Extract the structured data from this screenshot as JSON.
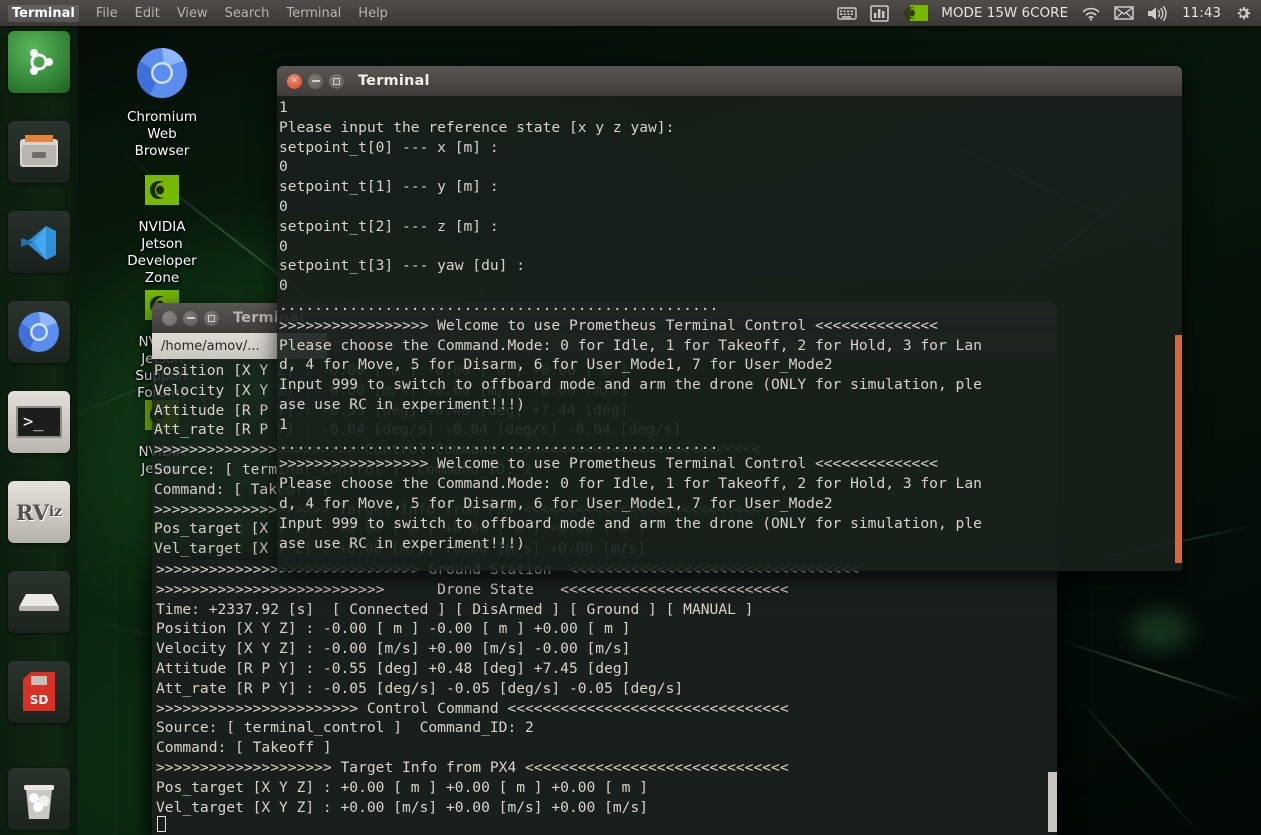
{
  "top_panel": {
    "app_name": "Terminal",
    "menus": [
      "File",
      "Edit",
      "View",
      "Search",
      "Terminal",
      "Help"
    ],
    "indicators": [
      {
        "name": "keyboard-indicator-icon",
        "glyph": "keyboard"
      },
      {
        "name": "system-monitor-icon",
        "glyph": "monitor"
      },
      {
        "name": "nvidia-logo-icon",
        "glyph": "nvidia"
      }
    ],
    "power_mode": "MODE 15W 6CORE",
    "wifi_label": "wifi",
    "mail_label": "mail",
    "volume_label": "volume",
    "clock": "11:43",
    "settings_label": "settings"
  },
  "launcher": {
    "items": [
      {
        "name": "ubuntu-dash-icon",
        "label": "Ubuntu Dash",
        "selected": false
      },
      {
        "name": "files-icon",
        "label": "Files",
        "selected": false
      },
      {
        "name": "vscode-icon",
        "label": "Visual Studio Code",
        "selected": false
      },
      {
        "name": "chromium-icon",
        "label": "Chromium Web Browser",
        "selected": false
      },
      {
        "name": "terminal-icon",
        "label": "Terminal",
        "selected": true
      },
      {
        "name": "rviz-icon",
        "label": "RViz",
        "selected": true
      },
      {
        "name": "disk-drive-icon",
        "label": "Disk Drive",
        "selected": false
      },
      {
        "name": "sd-card-icon",
        "label": "SD Card",
        "selected": false
      },
      {
        "name": "trash-icon",
        "label": "Trash",
        "selected": false
      }
    ]
  },
  "desktop_icons": [
    {
      "name": "desktop-icon-chromium",
      "label": "Chromium\nWeb\nBrowser",
      "icon": "chromium-icon"
    },
    {
      "name": "desktop-icon-jetson-developer-zone",
      "label": "NVIDIA\nJetson\nDeveloper\nZone",
      "icon": "nvidia-icon"
    },
    {
      "name": "desktop-icon-jetson-support-forums",
      "label": "NVIDIA\nJetson\nSupport\nForums",
      "icon": "nvidia-icon"
    },
    {
      "name": "desktop-icon-jetson-third",
      "label": "NVIDIA\nJetson",
      "icon": "nvidia-icon"
    }
  ],
  "window_back": {
    "title": "Terminal",
    "tab_label": "/home/amov/...",
    "buttons": {
      "close": "×",
      "minimize": "–",
      "maximize": "□"
    },
    "output": "Position [X Y Z] : -0.00 [ m ] -0.00 [ m ] +0.00 [ m ]\nVelocity [X Y Z] : -0.00 [m/s] +0.00 [m/s] -0.00 [m/s]\nAttitude [R P Y] : -0.55 [deg] +0.48 [deg] +7.44 [deg]\nAtt_rate [R P Y] : -0.04 [deg/s] -0.04 [deg/s] -0.04 [deg/s]\n>>>>>>>>>>>>>>>>>>>>>>> Control Command <<<<<<<<<<<<<<<<<<<<<<<<<<<<<\nSource: [ terminal_control ]  Command_ID: 2\nCommand: [ Takeoff ]\n>>>>>>>>>>>>>>>>>>>> Target Info from PX4 <<<<<<<<<<<<<<<<<<<<<<<<<<<\nPos_target [X Y Z] : +0.00 [ m ] +0.00 [ m ] +0.00 [ m ]\nVel_target [X Y Z] : +0.00 [m/s] +0.00 [m/s] +0.00 [m/s]"
  },
  "window_front": {
    "title": "Terminal",
    "buttons": {
      "close": "×",
      "minimize": "–",
      "maximize": "□"
    },
    "output": "1\nPlease input the reference state [x y z yaw]:\nsetpoint_t[0] --- x [m] :\n0\nsetpoint_t[1] --- y [m] :\n0\nsetpoint_t[2] --- z [m] :\n0\nsetpoint_t[3] --- yaw [du] :\n0\n..................................................\n>>>>>>>>>>>>>>>>> Welcome to use Prometheus Terminal Control <<<<<<<<<<<<<<\nPlease choose the Command.Mode: 0 for Idle, 1 for Takeoff, 2 for Hold, 3 for Lan\nd, 4 for Move, 5 for Disarm, 6 for User_Mode1, 7 for User_Mode2\nInput 999 to switch to offboard mode and arm the drone (ONLY for simulation, ple\nase use RC in experiment!!!)\n1\n..................................................\n>>>>>>>>>>>>>>>>> Welcome to use Prometheus Terminal Control <<<<<<<<<<<<<<\nPlease choose the Command.Mode: 0 for Idle, 1 for Takeoff, 2 for Hold, 3 for Lan\nd, 4 for Move, 5 for Disarm, 6 for User_Mode1, 7 for User_Mode2\nInput 999 to switch to offboard mode and arm the drone (ONLY for simulation, ple\nase use RC in experiment!!!)"
  },
  "window_bottom": {
    "output": ">>>>>>>>>>>>>>>>>>>>>>>>>>>>>> Ground Station  <<<<<<<<<<<<<<<<<<<<<<<<<<<<<<<<<\n>>>>>>>>>>>>>>>>>>>>>>>>>>      Drone State   <<<<<<<<<<<<<<<<<<<<<<<<<<\nTime: +2337.92 [s]  [ Connected ] [ DisArmed ] [ Ground ] [ MANUAL ]\nPosition [X Y Z] : -0.00 [ m ] -0.00 [ m ] +0.00 [ m ]\nVelocity [X Y Z] : -0.00 [m/s] +0.00 [m/s] -0.00 [m/s]\nAttitude [R P Y] : -0.55 [deg] +0.48 [deg] +7.45 [deg]\nAtt_rate [R P Y] : -0.05 [deg/s] -0.05 [deg/s] -0.05 [deg/s]\n>>>>>>>>>>>>>>>>>>>>>>> Control Command <<<<<<<<<<<<<<<<<<<<<<<<<<<<<<<<\nSource: [ terminal_control ]  Command_ID: 2\nCommand: [ Takeoff ]\n>>>>>>>>>>>>>>>>>>>> Target Info from PX4 <<<<<<<<<<<<<<<<<<<<<<<<<<<<<<\nPos_target [X Y Z] : +0.00 [ m ] +0.00 [ m ] +0.00 [ m ]\nVel_target [X Y Z] : +0.00 [m/s] +0.00 [m/s] +0.00 [m/s]"
  },
  "colors": {
    "panel": "#454240",
    "terminal_bg": "#1a221d",
    "terminal_fg": "#d7d3cc",
    "scrollbar_active": "#d8663a",
    "accent_green": "#76b900"
  }
}
